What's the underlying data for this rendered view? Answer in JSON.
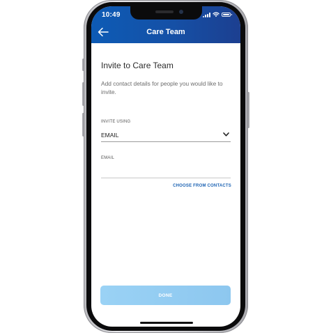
{
  "status_bar": {
    "time": "10:49"
  },
  "header": {
    "title": "Care Team",
    "back_icon": "arrow-left-icon",
    "gradient_colors": [
      "#0d5bb5",
      "#1c3f90"
    ]
  },
  "form": {
    "heading": "Invite to Care Team",
    "description": "Add contact details for people you would like to invite.",
    "invite_using": {
      "label": "INVITE USING",
      "selected": "EMAIL",
      "icon": "chevron-down-icon"
    },
    "email": {
      "label": "EMAIL",
      "value": "",
      "placeholder": ""
    },
    "choose_contacts_label": "CHOOSE FROM CONTACTS",
    "done_label": "DONE"
  },
  "colors": {
    "link": "#1b62b3",
    "done_button": "#9ad2f5"
  }
}
